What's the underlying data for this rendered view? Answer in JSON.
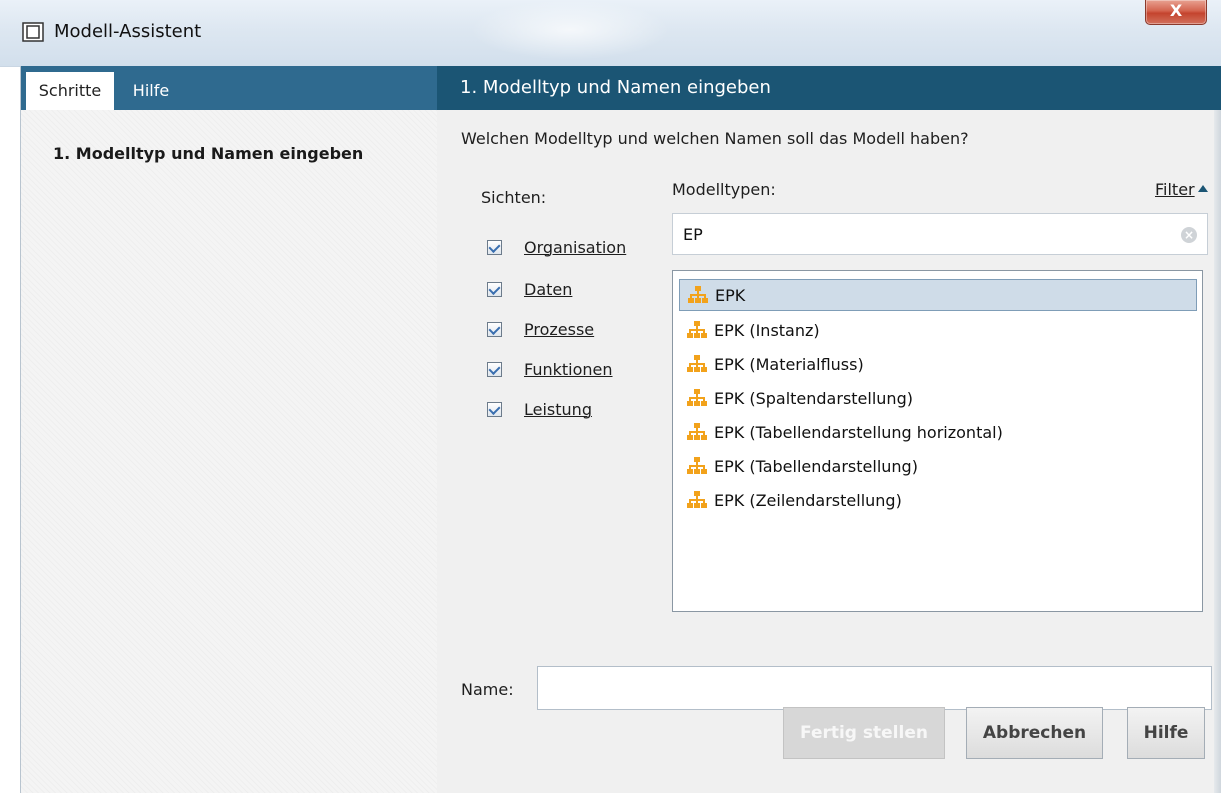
{
  "window": {
    "title": "Modell-Assistent",
    "close_glyph": "X",
    "icon": "window-icon"
  },
  "left": {
    "tabs": [
      {
        "label": "Schritte",
        "active": true
      },
      {
        "label": "Hilfe",
        "active": false
      }
    ],
    "steps": [
      "1. Modelltyp und Namen eingeben"
    ]
  },
  "right": {
    "header": "1. Modelltyp und Namen eingeben",
    "question": "Welchen Modelltyp und welchen Namen soll das Modell haben?",
    "views_label": "Sichten:",
    "views": [
      {
        "label": "Organisation",
        "checked": true
      },
      {
        "label": "Daten",
        "checked": true
      },
      {
        "label": "Prozesse",
        "checked": true
      },
      {
        "label": "Funktionen",
        "checked": true
      },
      {
        "label": "Leistung",
        "checked": true
      }
    ],
    "model_types_label": "Modelltypen:",
    "filter_label": "Filter",
    "search_value": "EP",
    "model_types": [
      {
        "label": "EPK",
        "selected": true
      },
      {
        "label": "EPK (Instanz)",
        "selected": false
      },
      {
        "label": "EPK (Materialfluss)",
        "selected": false
      },
      {
        "label": "EPK (Spaltendarstellung)",
        "selected": false
      },
      {
        "label": "EPK (Tabellendarstellung horizontal)",
        "selected": false
      },
      {
        "label": "EPK (Tabellendarstellung)",
        "selected": false
      },
      {
        "label": "EPK (Zeilendarstellung)",
        "selected": false
      }
    ],
    "name_label": "Name:",
    "name_value": ""
  },
  "buttons": {
    "finish": "Fertig stellen",
    "cancel": "Abbrechen",
    "help": "Hilfe"
  },
  "colors": {
    "header_bg": "#1b5574",
    "tabbar_bg": "#2f6a8f",
    "selection_bg": "#cfdce8",
    "icon_orange": "#f2a21b"
  }
}
